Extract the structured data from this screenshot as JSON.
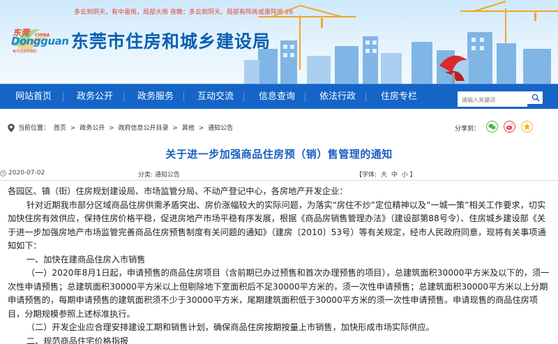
{
  "header": {
    "weather": "多云到阴天，有中雷雨，局部大雨 夜晚：多云到阴天，局部有阵雨或雷阵雨 26",
    "logo_cn": "东莞",
    "logo_china": "CHINA",
    "logo_en": "Dongguan",
    "logo_slogan": "每天绽放新精彩",
    "site_title": "东莞市住房和城乡建设局"
  },
  "nav": {
    "items": [
      "网站首页",
      "政务公开",
      "政务服务",
      "互动交流",
      "信息查询",
      "依法行政",
      "住房专栏"
    ],
    "search_placeholder": "请输入关键词"
  },
  "breadcrumb": {
    "items": [
      "首页",
      "政务公开",
      "政府信息公开目录",
      "其他",
      "通知公告"
    ],
    "separator": ">",
    "share_label": "分享到："
  },
  "article": {
    "title": "关于进一步加强商品住房预（销）售管理的通知",
    "date": "2020-07-02",
    "category_label": "分类:",
    "category": "通知公告",
    "font_label": "【字体:",
    "font_sizes": [
      "大",
      "中",
      "小"
    ],
    "font_close": "】",
    "paragraphs": [
      "各园区、镇（街）住房规划建设局、市场监管分局、不动产登记中心，各房地产开发企业：",
      "针对近期我市部分区域商品住房供需矛盾突出、房价涨幅较大的实际问题，为落实“房住不炒”定位精神以及“一城一策”相关工作要求，切实加快住房有效供应，保持住房价格平稳，促进房地产市场平稳有序发展，根据《商品房销售管理办法》（建设部第88号令）、住房城乡建设部《关于进一步加强房地产市场监管完善商品住房预售制度有关问题的通知》（建房〔2010〕53号）等有关规定，经市人民政府同意，现将有关事项通知如下：",
      "一、加快在建商品住房入市销售",
      "（一）2020年8月1日起，申请预售的商品住房项目（含前期已办过预售和首次办理预售的项目），总建筑面积30000平方米及以下的，须一次性申请预售；总建筑面积30000平方米以上但剔除地下室面积后不足30000平方米的，须一次性申请预售；总建筑面积30000平方米以上分期申请预售的，每期申请预售的建筑面积须不少于30000平方米，尾期建筑面积低于30000平方米的须一次性申请预售。申请现售的商品住房项目，分期规模参照上述标准执行。",
      "（二）开发企业应合理安排建设工期和销售计划，确保商品住房按期按量上市销售，加快形成市场实际供应。",
      "二、规范商品住宅价格指报"
    ]
  },
  "colors": {
    "nav_bg": "#1565c8",
    "title_blue": "#1a5fc0",
    "site_title_blue": "#0a5fb0",
    "weather_red": "#e0463a"
  }
}
